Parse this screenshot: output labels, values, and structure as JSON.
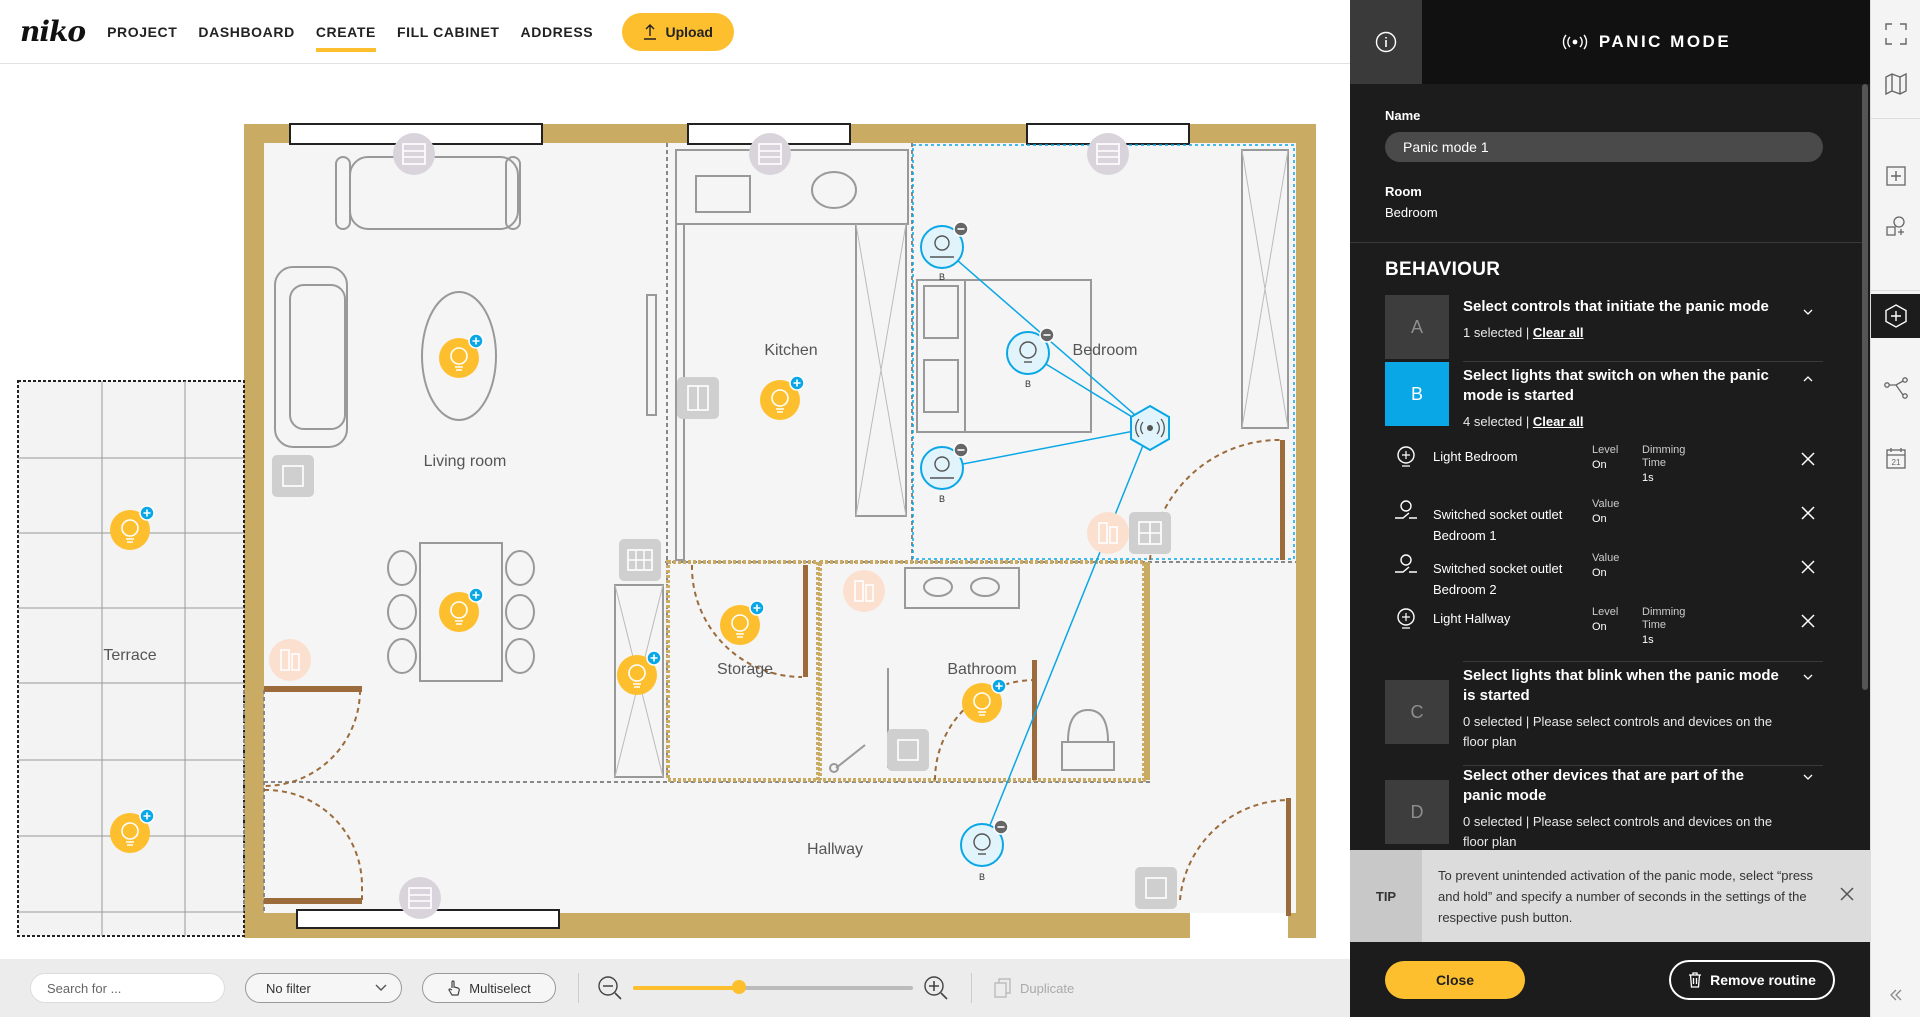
{
  "app": {
    "logo": "niko",
    "nav": [
      {
        "label": "PROJECT",
        "active": false
      },
      {
        "label": "DASHBOARD",
        "active": false
      },
      {
        "label": "CREATE",
        "active": true
      },
      {
        "label": "FILL CABINET",
        "active": false
      },
      {
        "label": "ADDRESS",
        "active": false
      }
    ],
    "upload_label": "Upload"
  },
  "floorplan": {
    "rooms": [
      {
        "label": "Living room"
      },
      {
        "label": "Kitchen"
      },
      {
        "label": "Bedroom"
      },
      {
        "label": "Terrace"
      },
      {
        "label": "Storage"
      },
      {
        "label": "Bathroom"
      },
      {
        "label": "Hallway"
      }
    ],
    "device_tag": "B"
  },
  "toolbar": {
    "search_placeholder": "Search for ...",
    "filter_value": "No filter",
    "multiselect_label": "Multiselect",
    "zoom_level": 0.38,
    "duplicate_label": "Duplicate"
  },
  "panel": {
    "title": "PANIC MODE",
    "name_label": "Name",
    "name_value": "Panic mode 1",
    "room_label": "Room",
    "room_value": "Bedroom",
    "behaviour_label": "BEHAVIOUR",
    "steps": [
      {
        "letter": "A",
        "title": "Select controls that initiate the panic mode",
        "count": "1 selected",
        "sep": " | ",
        "action": "Clear all"
      },
      {
        "letter": "B",
        "title": "Select lights that switch on when the panic mode is started",
        "count": "4 selected",
        "sep": " | ",
        "action": "Clear all"
      },
      {
        "letter": "C",
        "title": "Select lights that blink when the panic mode is started",
        "count": "0 selected",
        "sep": " | ",
        "hint": "Please select controls and devices on the floor plan"
      },
      {
        "letter": "D",
        "title": "Select other devices that are part of the panic mode",
        "count": "0 selected",
        "sep": " | ",
        "hint": "Please select controls and devices on the floor plan"
      }
    ],
    "devices": [
      {
        "name": "Light Bedroom",
        "c1_label": "Level",
        "c1_value": "On",
        "c2_label": "Dimming Time",
        "c2_value": "1s",
        "icon": "bulb-icon"
      },
      {
        "name": "Switched socket outlet Bedroom 1",
        "c1_label": "Value",
        "c1_value": "On",
        "icon": "socket-icon"
      },
      {
        "name": "Switched socket outlet Bedroom 2",
        "c1_label": "Value",
        "c1_value": "On",
        "icon": "socket-icon"
      },
      {
        "name": "Light Hallway",
        "c1_label": "Level",
        "c1_value": "On",
        "c2_label": "Dimming Time",
        "c2_value": "1s",
        "icon": "bulb-icon"
      }
    ],
    "tip_tag": "TIP",
    "tip_text": "To prevent unintended activation of the panic mode, select “press and hold” and specify a number of seconds in the settings of the respective push button.",
    "close_label": "Close",
    "remove_label": "Remove routine"
  },
  "colors": {
    "accent": "#fdbf2d",
    "selection": "#0aa7e6",
    "wall": "#c9ab63",
    "panel": "#1c1c1c"
  }
}
